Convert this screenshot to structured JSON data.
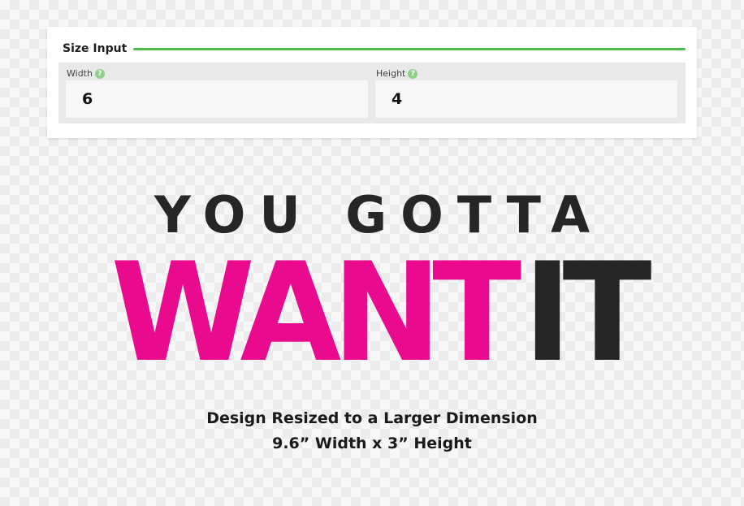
{
  "panel": {
    "title": "Size Input",
    "accent_color": "#4cbb4a",
    "width_field": {
      "label": "Width",
      "value": "6",
      "help_icon": "help-question-icon"
    },
    "height_field": {
      "label": "Height",
      "value": "4",
      "help_icon": "help-question-icon"
    }
  },
  "design": {
    "line1": "YOU GOTTA",
    "word1": "WANT",
    "word2": "IT",
    "color_pink": "#ea0a8e",
    "color_dark": "#262626"
  },
  "caption": {
    "line1": "Design Resized to a Larger Dimension",
    "line2": "9.6” Width x 3” Height"
  }
}
